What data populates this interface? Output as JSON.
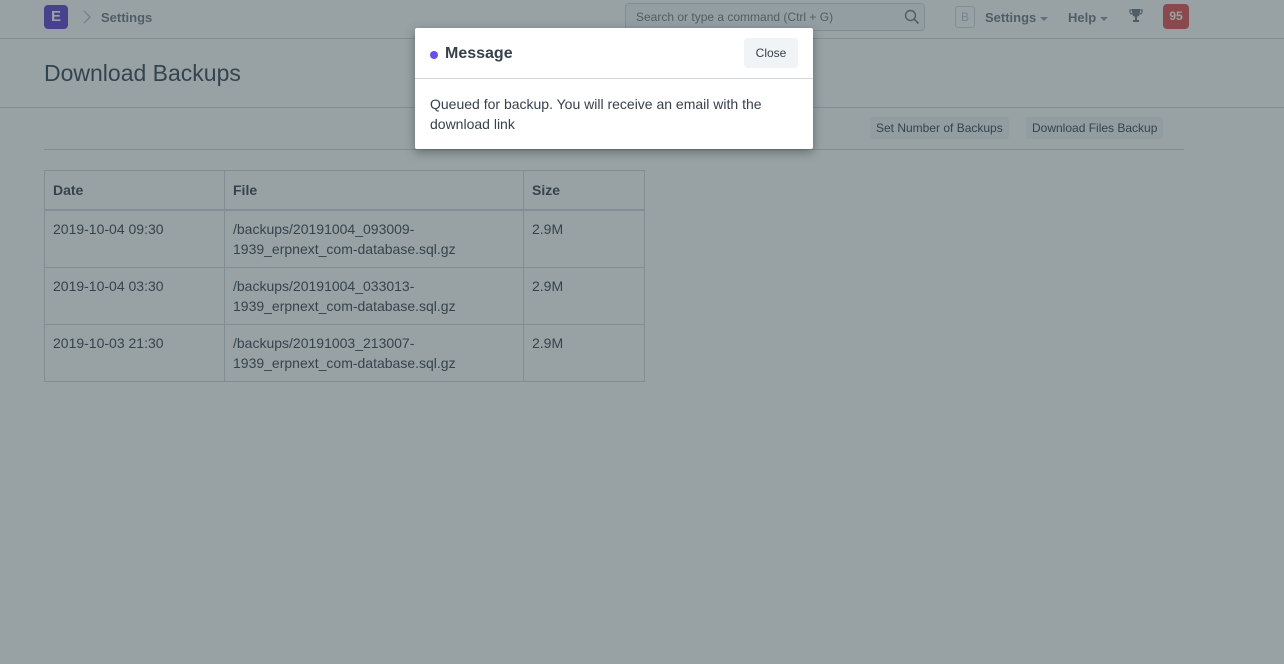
{
  "navbar": {
    "logo_letter": "E",
    "breadcrumb": "Settings",
    "search_placeholder": "Search or type a command (Ctrl + G)",
    "avatar_letter": "B",
    "menus": [
      "Settings",
      "Help"
    ],
    "notification_count": "95",
    "icons": {
      "breadcrumb": "chevron-right-icon",
      "search": "search-icon",
      "trophy": "trophy-icon"
    }
  },
  "page": {
    "title": "Download Backups",
    "toolbar": {
      "set_number_label": "Set Number of Backups",
      "download_files_label": "Download Files Backup"
    }
  },
  "table": {
    "headers": [
      "Date",
      "File",
      "Size"
    ],
    "rows": [
      {
        "date": "2019-10-04 09:30",
        "file_line1": "/backups/20191004_093009-",
        "file_line2": "1939_erpnext_com-database.sql.gz",
        "size": "2.9M"
      },
      {
        "date": "2019-10-04 03:30",
        "file_line1": "/backups/20191004_033013-",
        "file_line2": "1939_erpnext_com-database.sql.gz",
        "size": "2.9M"
      },
      {
        "date": "2019-10-03 21:30",
        "file_line1": "/backups/20191003_213007-",
        "file_line2": "1939_erpnext_com-database.sql.gz",
        "size": "2.9M"
      }
    ]
  },
  "modal": {
    "title": "Message",
    "close_label": "Close",
    "body": "Queued for backup. You will receive an email with the download link",
    "indicator_color": "#6a4ff0"
  },
  "colors": {
    "brand": "#5e3fd1",
    "notification": "#e24c4c"
  }
}
